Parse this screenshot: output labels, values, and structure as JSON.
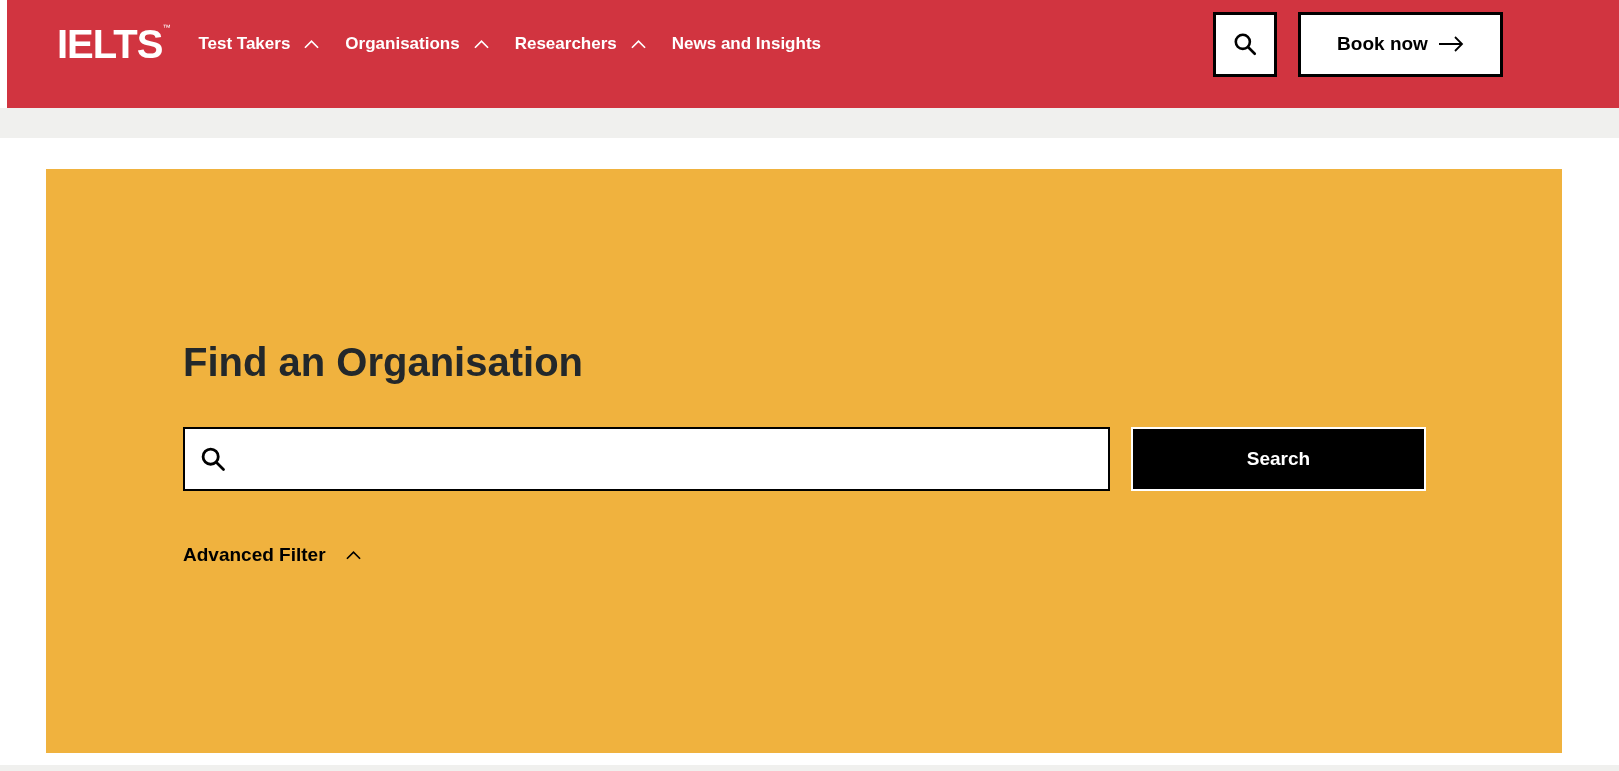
{
  "header": {
    "logo": "IELTS",
    "trademark": "™",
    "nav": [
      {
        "label": "Test Takers",
        "kind": "menu",
        "expanded": true
      },
      {
        "label": "Organisations",
        "kind": "menu",
        "expanded": true
      },
      {
        "label": "Researchers",
        "kind": "menu",
        "expanded": true
      },
      {
        "label": "News and Insights",
        "kind": "link"
      }
    ],
    "book_button": "Book now"
  },
  "finder": {
    "title": "Find an Organisation",
    "search_button": "Search",
    "advanced_filter": {
      "label": "Advanced Filter",
      "expanded": true
    }
  }
}
